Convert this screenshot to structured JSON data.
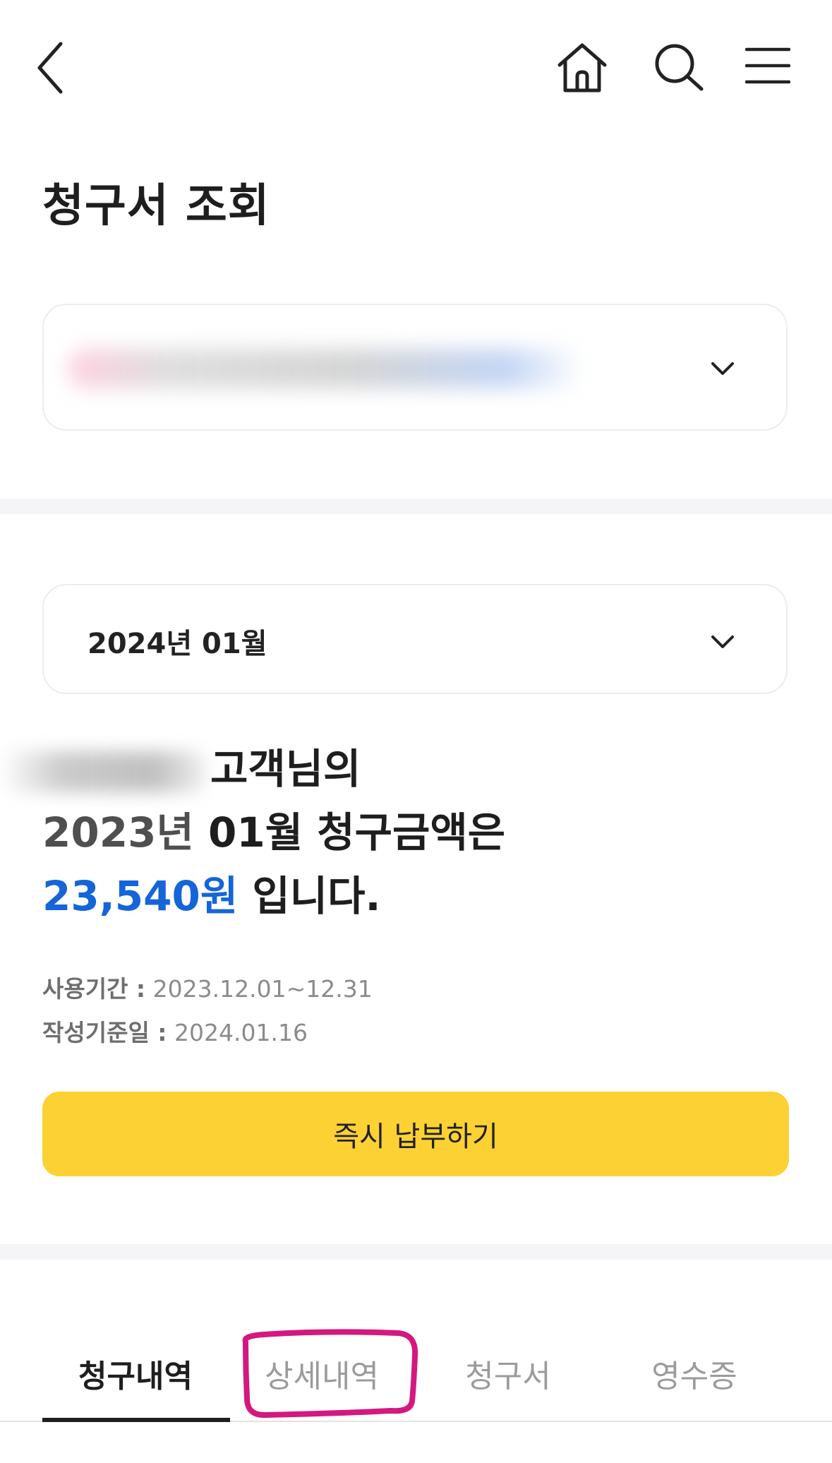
{
  "header": {
    "back_icon": "chevron-left-icon",
    "home_icon": "home-icon",
    "search_icon": "search-icon",
    "menu_icon": "hamburger-menu-icon"
  },
  "page": {
    "title": "청구서 조회"
  },
  "account_select": {
    "value": "",
    "icon": "chevron-down-icon"
  },
  "month_select": {
    "value": "2024년 01월",
    "icon": "chevron-down-icon"
  },
  "summary": {
    "customer_suffix": "고객님의",
    "period_part1": "2023년",
    "period_part2": " 01월 청구금액은",
    "amount": "23,540원",
    "amount_suffix": " 입니다."
  },
  "meta": {
    "usage_label": "사용기간 :",
    "usage_value": " 2023.12.01~12.31",
    "created_label": "작성기준일 :",
    "created_value": " 2024.01.16"
  },
  "pay_button": {
    "label": "즉시 납부하기",
    "color": "#fcd133"
  },
  "tabs": [
    {
      "label": "청구내역",
      "active": true
    },
    {
      "label": "상세내역",
      "active": false
    },
    {
      "label": "청구서",
      "active": false
    },
    {
      "label": "영수증",
      "active": false
    }
  ],
  "colors": {
    "accent_amount": "#1565d8",
    "highlight_annotation": "#d4187f"
  }
}
